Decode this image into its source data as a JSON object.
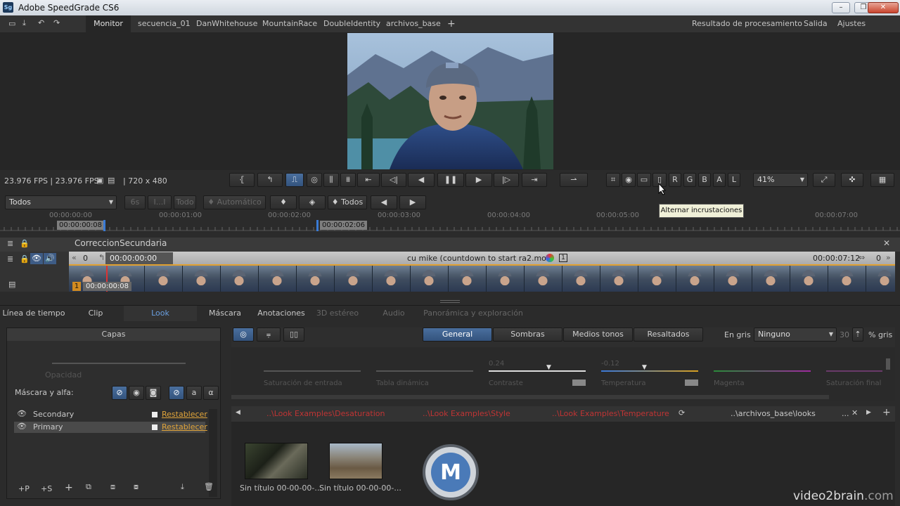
{
  "window": {
    "title": "Adobe SpeedGrade CS6",
    "app_icon": "Sg"
  },
  "menu": {
    "tabs": [
      "Monitor",
      "secuencia_01",
      "DanWhitehouse",
      "MountainRace",
      "DoubleIdentity",
      "archivos_base"
    ],
    "right": [
      "Resultado de procesamiento",
      "Salida",
      "Ajustes"
    ],
    "add": "+"
  },
  "status": {
    "fps": "23.976 FPS  |  23.976 FPS",
    "res": "|  720 x 480",
    "zoom": "41%"
  },
  "channel_buttons": [
    "R",
    "G",
    "B",
    "A",
    "L"
  ],
  "toolbar2": {
    "filter": "Todos",
    "b1": "6s",
    "b2": "I...I",
    "b3": "Todo",
    "auto": "Automático",
    "todos": "Todos"
  },
  "ruler": {
    "ticks": [
      "00:00:00:00",
      "00:00:01:00",
      "00:00:02:00",
      "00:00:03:00",
      "00:00:04:00",
      "00:00:05:00",
      "00:00:07:00"
    ],
    "in_tc": "00:00:00:08",
    "out_tc": "00:00:02:06"
  },
  "tooltip": "Alternar incrustaciones",
  "track": {
    "name": "CorreccionSecundaria",
    "left_num": "0",
    "start_tc": "00:00:00:00",
    "clip_name": "cu mike (countdown to start ra2.mov",
    "end_tc": "00:00:07:12",
    "right_num": "0",
    "marker": "1",
    "clip_tc": "00:00:00:08",
    "badge": "1"
  },
  "bottom_tabs": [
    "Línea de tiempo",
    "Clip",
    "Look",
    "Máscara",
    "Anotaciones",
    "3D estéreo",
    "Audio",
    "Panorámica y exploración"
  ],
  "layers": {
    "title": "Capas",
    "opacity": "Opacidad",
    "mask_label": "Máscara y alfa:",
    "items": [
      {
        "name": "Secondary",
        "reset": "Restablecer"
      },
      {
        "name": "Primary",
        "reset": "Restablecer"
      }
    ],
    "footer": [
      "+P",
      "+S"
    ]
  },
  "look": {
    "tones": [
      "General",
      "Sombras",
      "Medios tonos",
      "Resaltados"
    ],
    "gray_label": "En gris",
    "gray_value": "Ninguno",
    "gray_num": "30",
    "gray_unit": "% gris",
    "sliders": [
      "Saturación de entrada",
      "Tabla dinámica",
      "Contraste",
      "Temperatura",
      "Magenta",
      "Saturación final"
    ],
    "contrast_val": "0.24",
    "temp_val": "-0.12"
  },
  "lookbar": {
    "paths": [
      "..\\Look Examples\\Desaturation",
      "..\\Look Examples\\Style",
      "..\\Look Examples\\Temperature"
    ],
    "current": "..\\archivos_base\\looks",
    "dots": "..."
  },
  "thumbs": [
    "Sin título 00-00-00-...",
    "Sin título 00-00-00-..."
  ],
  "watermark": {
    "brand": "video2brain",
    "suffix": ".com"
  }
}
